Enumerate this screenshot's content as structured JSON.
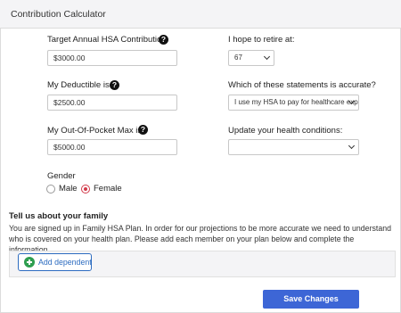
{
  "header": {
    "title": "Contribution Calculator"
  },
  "form": {
    "target_contribution": {
      "label": "Target Annual HSA Contribution:",
      "value": "$3000.00"
    },
    "deductible": {
      "label": "My Deductible is:",
      "value": "$2500.00"
    },
    "out_of_pocket": {
      "label": "My Out-Of-Pocket Max is:",
      "value": "$5000.00"
    },
    "retire_age": {
      "label": "I hope to retire at:",
      "selected": "67"
    },
    "statements": {
      "label": "Which of these statements is accurate?",
      "selected": "I use my HSA to pay for healthcare exp"
    },
    "health_conditions": {
      "label": "Update your health conditions:",
      "selected": ""
    },
    "gender": {
      "label": "Gender",
      "options": [
        "Male",
        "Female"
      ],
      "selected": "Female"
    }
  },
  "help_icon_glyph": "?",
  "family": {
    "title": "Tell us about your family",
    "text": "You are signed up in Family HSA Plan. In order for our projections to be more accurate we need to understand who is covered on your health plan. Please add each member on your plan below and complete the information.",
    "add_dependent_label": "Add dependent"
  },
  "actions": {
    "save_label": "Save Changes"
  },
  "colors": {
    "accent": "#3d66d6",
    "radio_selected": "#d23a4a",
    "add_icon": "#2e9e4f"
  }
}
